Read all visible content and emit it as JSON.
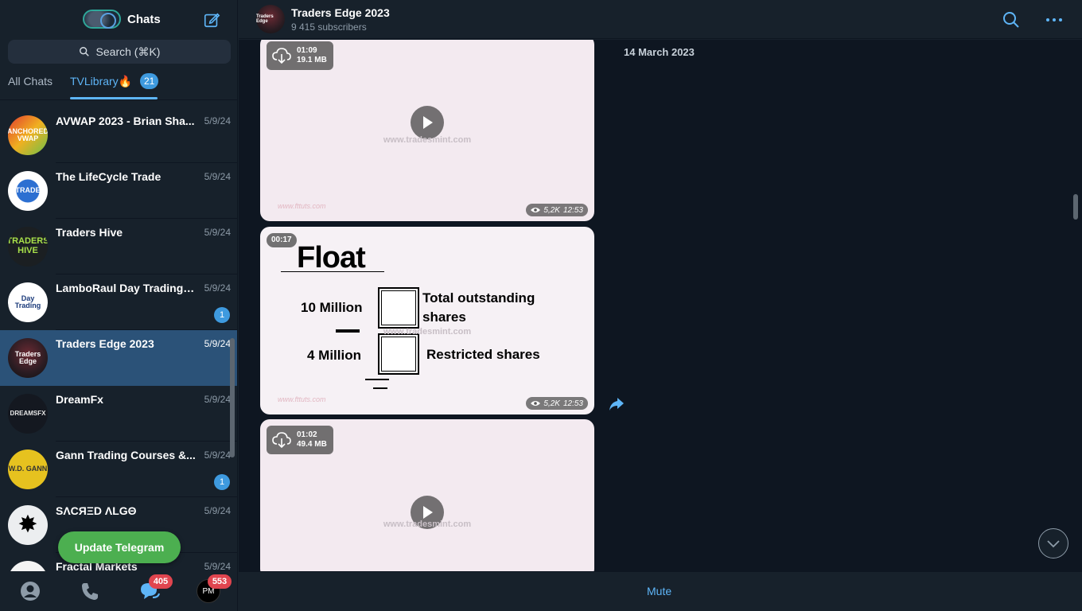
{
  "sidebar": {
    "title": "Chats",
    "search_placeholder": "Search (⌘K)",
    "tabs": [
      {
        "label": "All Chats"
      },
      {
        "label": "TVLibrary🔥",
        "badge": "21"
      }
    ],
    "chats": [
      {
        "name": "AVWAP 2023 - Brian Sha...",
        "date": "5/9/24",
        "avatar_text": "ANCHORED VWAP"
      },
      {
        "name": "The LifeCycle Trade",
        "date": "5/9/24",
        "avatar_text": "TRADE"
      },
      {
        "name": "Traders Hive",
        "date": "5/9/24",
        "avatar_text": "TRADERS HIVE"
      },
      {
        "name": "LamboRaul Day Trading I...",
        "date": "5/9/24",
        "unread": "1",
        "avatar_text": "Day Trading"
      },
      {
        "name": "Traders Edge 2023",
        "date": "5/9/24",
        "active": true,
        "avatar_text": "Traders Edge"
      },
      {
        "name": "DreamFx",
        "date": "5/9/24",
        "avatar_text": "DREAMSFX"
      },
      {
        "name": "Gann Trading Courses &...",
        "date": "5/9/24",
        "unread": "1",
        "avatar_text": "W.D. GANN"
      },
      {
        "name": "SΛCЯΞD ΛLGΘ",
        "date": "5/9/24",
        "avatar_text": "✸"
      },
      {
        "name": "Fractal Markets",
        "date": "5/9/24",
        "avatar_text": ""
      }
    ],
    "update_button": "Update Telegram",
    "bottom_bar": {
      "chats_badge": "405",
      "profile_badge": "553",
      "profile_text": "PM"
    }
  },
  "channel": {
    "name": "Traders Edge 2023",
    "subscribers": "9 415 subscribers",
    "avatar_text": "Traders Edge"
  },
  "messages": {
    "date_label": "14 March 2023",
    "media": [
      {
        "duration": "01:09",
        "size": "19.1 MB",
        "views": "5,2K",
        "time": "12:53",
        "watermark": "www.tradesmint.com",
        "watermark2": "www.fttuts.com"
      },
      {
        "duration": "00:17",
        "views": "5,2K",
        "time": "12:53",
        "watermark": "www.tradesmint.com",
        "watermark2": "www.fttuts.com",
        "slide": {
          "title": "Float",
          "line1_value": "10 Million",
          "line1_label_a": "Total outstanding",
          "line1_label_b": "shares",
          "line2_value": "4 Million",
          "line2_label": "Restricted shares"
        }
      },
      {
        "duration": "01:02",
        "size": "49.4 MB",
        "watermark": "www.tradesmint.com"
      }
    ]
  },
  "footer": {
    "mute_label": "Mute"
  },
  "colors": {
    "accent": "#5eb5f7",
    "active_row": "#2b5278",
    "update_green": "#4caf50",
    "badge_red": "#e0454f"
  }
}
